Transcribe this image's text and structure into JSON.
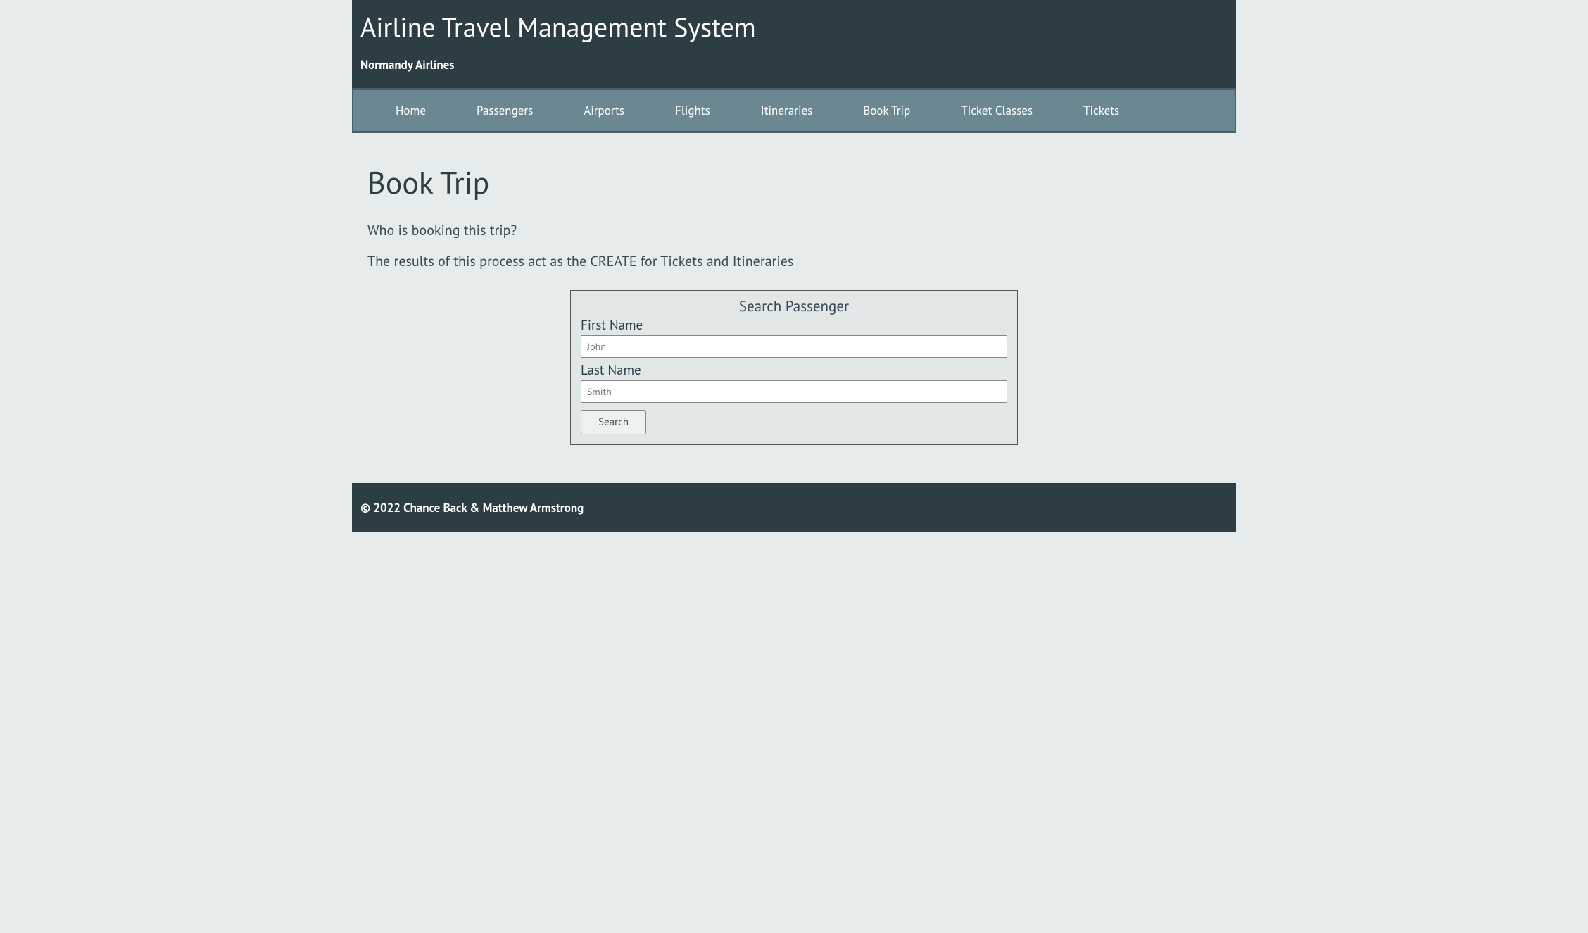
{
  "header": {
    "title": "Airline Travel Management System",
    "subtitle": "Normandy Airlines"
  },
  "nav": {
    "items": [
      "Home",
      "Passengers",
      "Airports",
      "Flights",
      "Itineraries",
      "Book Trip",
      "Ticket Classes",
      "Tickets"
    ]
  },
  "main": {
    "page_title": "Book Trip",
    "question": "Who is booking this trip?",
    "description": "The results of this process act as the CREATE for Tickets and Itineraries"
  },
  "search_form": {
    "title": "Search Passenger",
    "first_name_label": "First Name",
    "first_name_placeholder": "John",
    "last_name_label": "Last Name",
    "last_name_placeholder": "Smith",
    "button_label": "Search"
  },
  "footer": {
    "text": "© 2022 Chance Back & Matthew Armstrong"
  }
}
